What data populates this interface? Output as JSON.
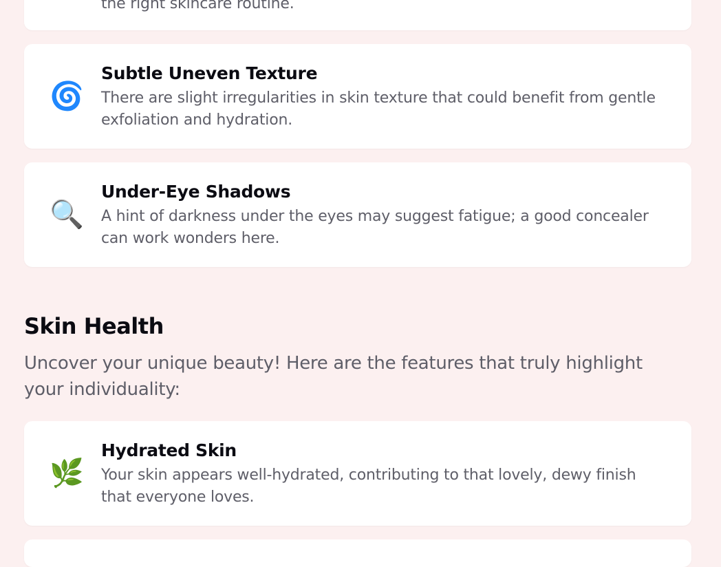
{
  "previous_card": {
    "desc_tail": "the right skincare routine."
  },
  "concerns": [
    {
      "icon": "spiral-icon",
      "glyph": "🌀",
      "title": "Subtle Uneven Texture",
      "desc": "There are slight irregularities in skin texture that could benefit from gentle exfoliation and hydration."
    },
    {
      "icon": "magnifying-glass-icon",
      "glyph": "🔍",
      "title": "Under-Eye Shadows",
      "desc": "A hint of darkness under the eyes may suggest fatigue; a good concealer can work wonders here."
    }
  ],
  "skin_health": {
    "title": "Skin Health",
    "intro": "Uncover your unique beauty! Here are the features that truly highlight your individuality:",
    "items": [
      {
        "icon": "herb-icon",
        "glyph": "🌿",
        "title": "Hydrated Skin",
        "desc": "Your skin appears well-hydrated, contributing to that lovely, dewy finish that everyone loves."
      }
    ]
  },
  "colors": {
    "background": "#fcf0f0",
    "card": "#ffffff",
    "title": "#0b0b12",
    "body_text": "#5e5e68"
  }
}
